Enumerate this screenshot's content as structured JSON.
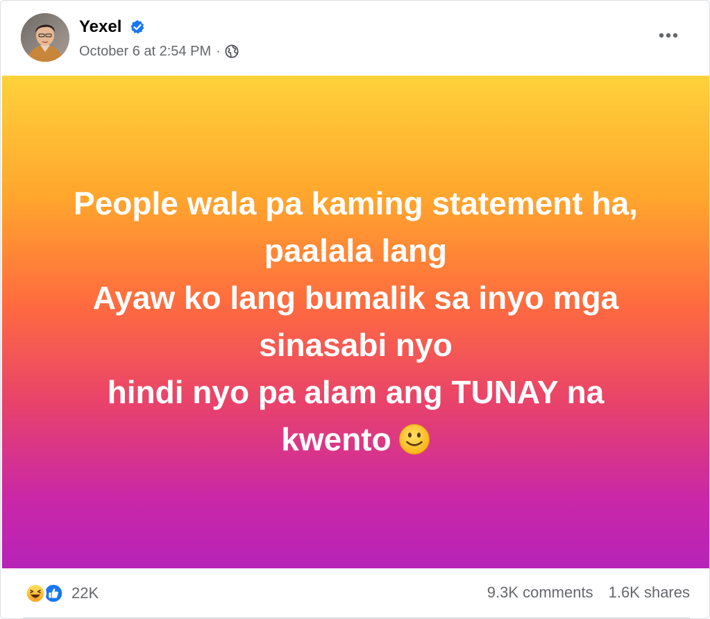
{
  "post": {
    "author": "Yexel",
    "timestamp": "October 6 at 2:54 PM",
    "separator": "·",
    "audience_icon": "globe-icon",
    "verified_icon": "verified-badge-icon",
    "status_lines": [
      "People wala pa kaming statement ha,",
      "paalala lang",
      "Ayaw ko lang bumalik sa inyo mga",
      "sinasabi nyo",
      "hindi nyo pa alam ang TUNAY na",
      "kwento"
    ],
    "status_emoji": "smiling-face-emoji",
    "background_colors": [
      "#ffd23a",
      "#ffa52d",
      "#ff6c3e",
      "#e9436a",
      "#c927a7",
      "#b723b8"
    ]
  },
  "footer": {
    "reaction_icons": [
      "haha-icon",
      "like-icon"
    ],
    "reaction_count": "22K",
    "comments": "9.3K comments",
    "shares": "1.6K shares"
  },
  "colors": {
    "verified_blue": "#1877f2",
    "secondary_text": "#65676b",
    "primary_text": "#050505"
  }
}
